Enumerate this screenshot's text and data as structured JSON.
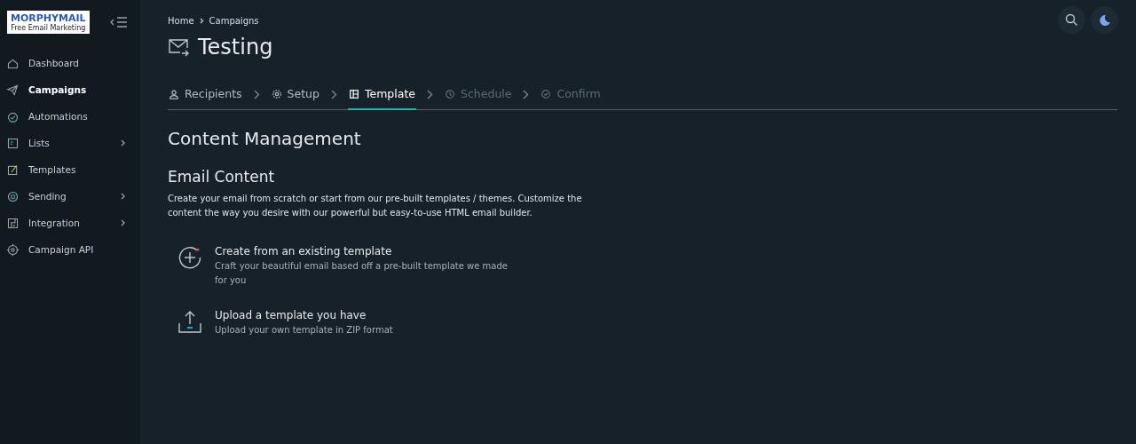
{
  "logo": {
    "name": "MORPHYMAIL",
    "tagline": "Free Email Marketing"
  },
  "sidebar": {
    "items": [
      {
        "label": "Dashboard",
        "selected": false,
        "has_submenu": false
      },
      {
        "label": "Campaigns",
        "selected": true,
        "has_submenu": false
      },
      {
        "label": "Automations",
        "selected": false,
        "has_submenu": false
      },
      {
        "label": "Lists",
        "selected": false,
        "has_submenu": true
      },
      {
        "label": "Templates",
        "selected": false,
        "has_submenu": false
      },
      {
        "label": "Sending",
        "selected": false,
        "has_submenu": true
      },
      {
        "label": "Integration",
        "selected": false,
        "has_submenu": true
      },
      {
        "label": "Campaign API",
        "selected": false,
        "has_submenu": false
      }
    ]
  },
  "breadcrumb": [
    "Home",
    "Campaigns"
  ],
  "page_title": "Testing",
  "steps": [
    {
      "label": "Recipients",
      "selected": false,
      "disabled": false
    },
    {
      "label": "Setup",
      "selected": false,
      "disabled": false
    },
    {
      "label": "Template",
      "selected": true,
      "disabled": false
    },
    {
      "label": "Schedule",
      "selected": false,
      "disabled": true
    },
    {
      "label": "Confirm",
      "selected": false,
      "disabled": true
    }
  ],
  "section_title": "Content Management",
  "subsection_title": "Email Content",
  "description": "Create your email from scratch or start from our pre-built templates / themes. Customize the content the way you desire with our powerful but easy-to-use HTML email builder.",
  "options": [
    {
      "title": "Create from an existing template",
      "text": "Craft your beautiful email based off a pre-built template we made for you"
    },
    {
      "title": "Upload a template you have",
      "text": "Upload your own template in ZIP format"
    }
  ]
}
